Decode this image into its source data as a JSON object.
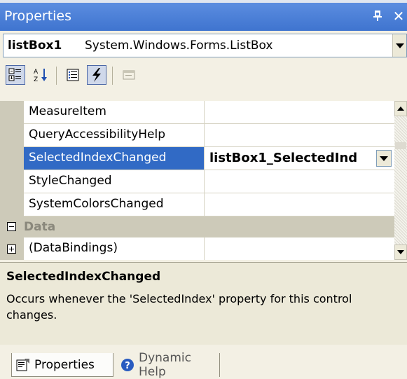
{
  "window": {
    "title": "Properties",
    "pin_glyph": "ᴨ",
    "close_glyph": "✕"
  },
  "object_selector": {
    "name": "listBox1",
    "type": "System.Windows.Forms.ListBox"
  },
  "toolbar": {
    "buttons": [
      {
        "icon": "categorized-icon",
        "active": true
      },
      {
        "icon": "alphabetical-icon",
        "active": false
      },
      {
        "icon": "properties-icon",
        "active": false
      },
      {
        "icon": "events-lightning-icon",
        "active": true
      },
      {
        "icon": "property-pages-icon",
        "active": false
      }
    ]
  },
  "grid": {
    "rows": [
      {
        "name": "MeasureItem",
        "value": ""
      },
      {
        "name": "QueryAccessibilityHelp",
        "value": ""
      },
      {
        "name": "SelectedIndexChanged",
        "value": "listBox1_SelectedInd",
        "selected": true
      },
      {
        "name": "StyleChanged",
        "value": ""
      },
      {
        "name": "SystemColorsChanged",
        "value": ""
      }
    ],
    "category": {
      "label": "Data",
      "expanded": true
    },
    "after_category_rows": [
      {
        "name": "(DataBindings)",
        "value": "",
        "expandable": true
      }
    ]
  },
  "description": {
    "title": "SelectedIndexChanged",
    "text": "Occurs whenever the 'SelectedIndex' property for this control changes."
  },
  "tabs": [
    {
      "label": "Properties",
      "icon": "properties-page-icon",
      "active": true
    },
    {
      "label": "Dynamic Help",
      "icon": "help-circle-icon",
      "active": false
    }
  ],
  "colors": {
    "titlebar": "#4d80d6",
    "selection": "#316ac5",
    "panel": "#ece9d8"
  }
}
